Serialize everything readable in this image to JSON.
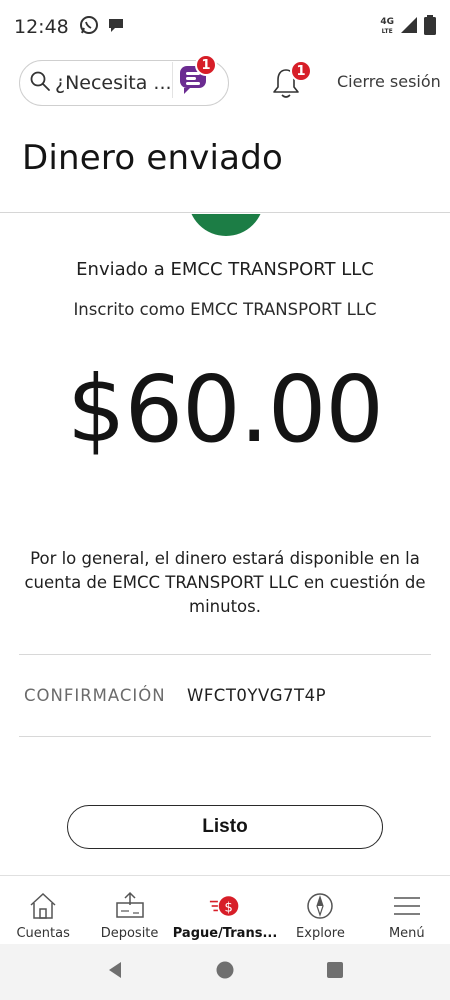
{
  "status_bar": {
    "time": "12:48",
    "network_label": "4G",
    "network_sub": "LTE",
    "icons": [
      "whatsapp-icon",
      "chat-icon",
      "signal-icon",
      "battery-icon"
    ]
  },
  "header": {
    "search_placeholder": "¿Necesita ...",
    "fargo_badge": "1",
    "notification_badge": "1",
    "logout_label": "Cierre sesión"
  },
  "page": {
    "title": "Dinero enviado",
    "sent_to": "Enviado a EMCC TRANSPORT LLC",
    "enrolled_as": "Inscrito como EMCC TRANSPORT LLC",
    "amount": "$60.00",
    "note": "Por lo general, el dinero estará disponible en la cuenta de EMCC TRANSPORT LLC en cuestión de minutos.",
    "confirmation_label": "CONFIRMACIÓN",
    "confirmation_value": "WFCT0YVG7T4P",
    "done_label": "Listo"
  },
  "bottom_nav": {
    "items": [
      {
        "label": "Cuentas",
        "icon": "home-icon",
        "active": false
      },
      {
        "label": "Deposite",
        "icon": "deposit-icon",
        "active": false
      },
      {
        "label": "Pague/Trans...",
        "icon": "pay-transfer-icon",
        "active": true
      },
      {
        "label": "Explore",
        "icon": "compass-icon",
        "active": false
      },
      {
        "label": "Menú",
        "icon": "hamburger-icon",
        "active": false
      }
    ]
  },
  "colors": {
    "brand_red": "#d71e28",
    "success_green": "#1c7d45",
    "brand_purple": "#6b2c91"
  }
}
